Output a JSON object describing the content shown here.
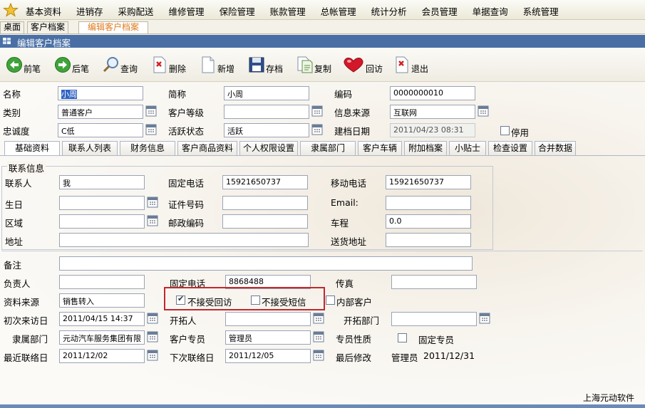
{
  "menubar": {
    "items": [
      "基本资料",
      "进销存",
      "采购配送",
      "维修管理",
      "保险管理",
      "账款管理",
      "总帐管理",
      "统计分析",
      "会员管理",
      "单据查询",
      "系统管理"
    ]
  },
  "tabs": [
    "桌面",
    "客户档案",
    "编辑客户档案"
  ],
  "title": "编辑客户档案",
  "toolbar": {
    "prev": "前笔",
    "next": "后笔",
    "query": "查询",
    "delete": "删除",
    "new": "新增",
    "save": "存档",
    "copy": "复制",
    "visit": "回访",
    "exit": "退出"
  },
  "header_fields": {
    "name_label": "名称",
    "name_value": "小周",
    "short_label": "简称",
    "short_value": "小周",
    "code_label": "编码",
    "code_value": "0000000010",
    "category_label": "类别",
    "category_value": "普通客户",
    "level_label": "客户等级",
    "level_value": "",
    "source_label": "信息来源",
    "source_value": "互联网",
    "loyalty_label": "忠诚度",
    "loyalty_value": "C低",
    "active_label": "活跃状态",
    "active_value": "活跃",
    "created_label": "建档日期",
    "created_value": "2011/04/23 08:31",
    "disabled_label": "停用"
  },
  "inner_tabs": [
    "基础资料",
    "联系人列表",
    "财务信息",
    "客户商品资料",
    "个人权限设置",
    "隶属部门",
    "客户车辆",
    "附加档案",
    "小贴士",
    "检查设置",
    "合并数据"
  ],
  "contact": {
    "group_title": "联系信息",
    "contact_label": "联系人",
    "contact_value": "我",
    "phone_label": "固定电话",
    "phone_value": "15921650737",
    "mobile_label": "移动电话",
    "mobile_value": "15921650737",
    "birthday_label": "生日",
    "birthday_value": "",
    "id_label": "证件号码",
    "id_value": "",
    "email_label": "Email:",
    "email_value": "",
    "region_label": "区域",
    "region_value": "",
    "zip_label": "邮政编码",
    "zip_value": "",
    "distance_label": "车程",
    "distance_value": "0.0",
    "address_label": "地址",
    "address_value": "",
    "delivery_label": "送货地址",
    "delivery_value": ""
  },
  "bottom": {
    "remark_label": "备注",
    "remark_value": "",
    "owner_label": "负责人",
    "owner_value": "",
    "phone_label": "固定电话",
    "phone_value": "8868488",
    "fax_label": "传真",
    "fax_value": "",
    "source_label": "资料来源",
    "source_value": "销售转入",
    "no_visit_label": "不接受回访",
    "no_visit_checked": true,
    "no_sms_label": "不接受短信",
    "no_sms_checked": false,
    "internal_label": "内部客户",
    "internal_checked": false,
    "first_visit_label": "初次来访日",
    "first_visit_value": "2011/04/15 14:37",
    "developer_label": "开拓人",
    "developer_value": "",
    "dept_label": "开拓部门",
    "dept_value": "",
    "belong_label": "隶属部门",
    "belong_value": "元动汽车服务集团有限",
    "agent_label": "客户专员",
    "agent_value": "管理员",
    "agent_type_label": "专员性质",
    "fixed_agent_label": "固定专员",
    "fixed_agent_checked": false,
    "last_contact_label": "最近联络日",
    "last_contact_value": "2011/12/02",
    "next_contact_label": "下次联络日",
    "next_contact_value": "2011/12/05",
    "last_modify_label": "最后修改",
    "last_modify_user": "管理员",
    "last_modify_date": "2011/12/31"
  },
  "footer": "上海元动软件"
}
